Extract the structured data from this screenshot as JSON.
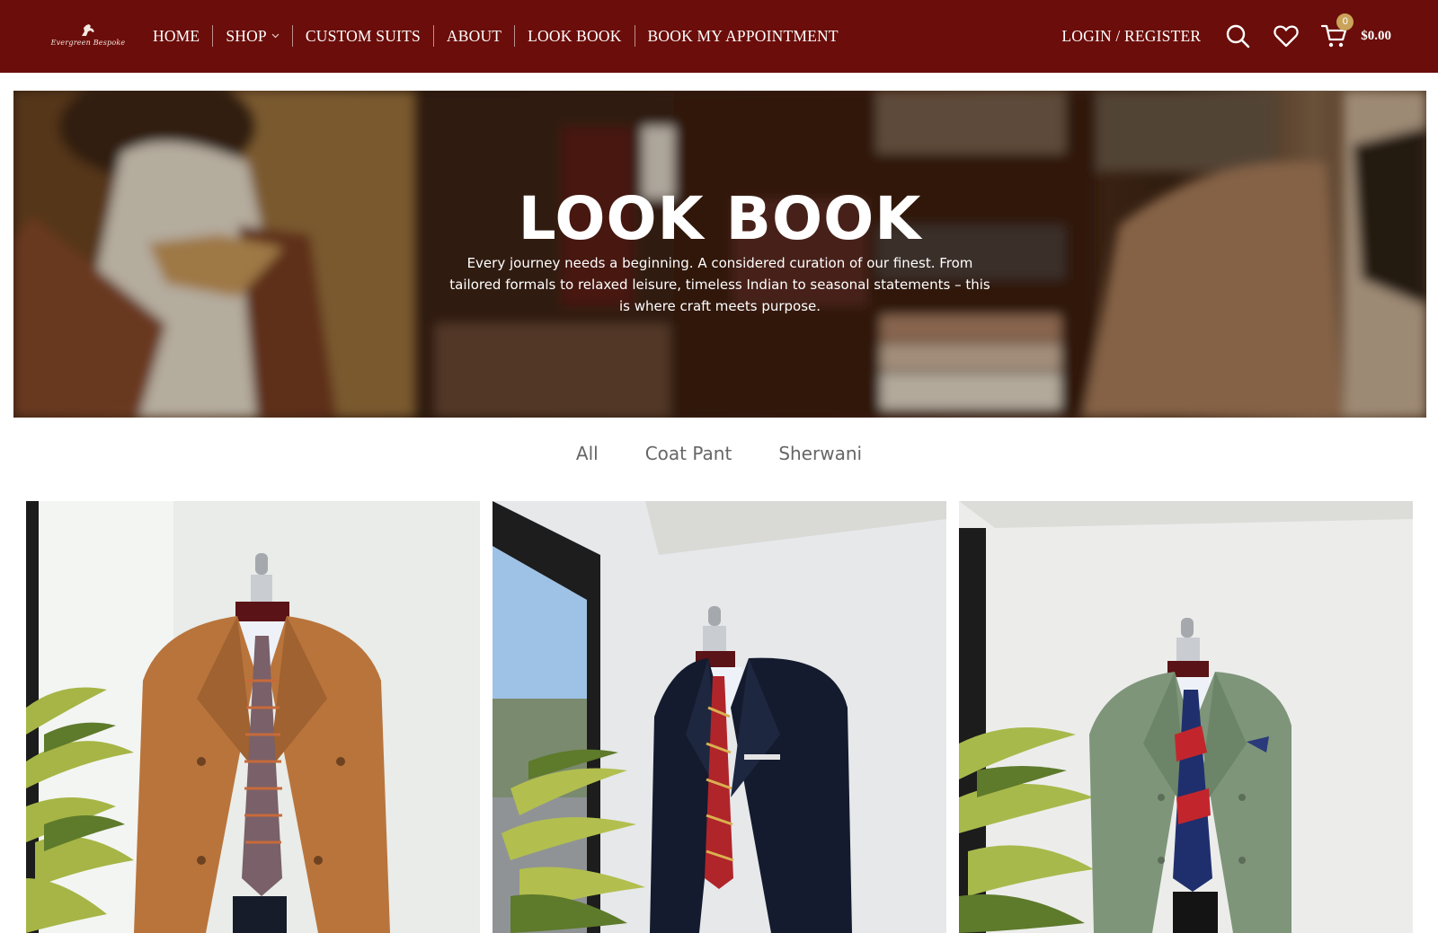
{
  "header": {
    "logo_text": "Evergreen Bespoke",
    "nav": [
      {
        "label": "HOME"
      },
      {
        "label": "SHOP",
        "has_dropdown": true
      },
      {
        "label": "CUSTOM SUITS"
      },
      {
        "label": "ABOUT"
      },
      {
        "label": "LOOK BOOK"
      },
      {
        "label": "BOOK MY APPOINTMENT"
      }
    ],
    "login_label": "LOGIN / REGISTER",
    "icons": [
      "search-icon",
      "heart-icon",
      "cart-icon"
    ],
    "cart_count": "0",
    "cart_total": "$0.00",
    "colors": {
      "header_bg": "#6b0d0a",
      "badge": "#c9a35a"
    }
  },
  "hero": {
    "title": "LOOK BOOK",
    "subtitle": "Every journey needs a beginning. A considered curation of our finest. From tailored formals to relaxed leisure, timeless Indian to seasonal statements – this is where craft meets purpose."
  },
  "filters": [
    {
      "label": "All"
    },
    {
      "label": "Coat Pant"
    },
    {
      "label": "Sherwani"
    }
  ],
  "gallery": [
    {
      "name": "tan-double-breasted-suit",
      "jacket_color": "#b9743c"
    },
    {
      "name": "navy-velvet-blazer",
      "jacket_color": "#141b2e"
    },
    {
      "name": "sage-green-double-breasted-suit",
      "jacket_color": "#7e957a"
    }
  ]
}
